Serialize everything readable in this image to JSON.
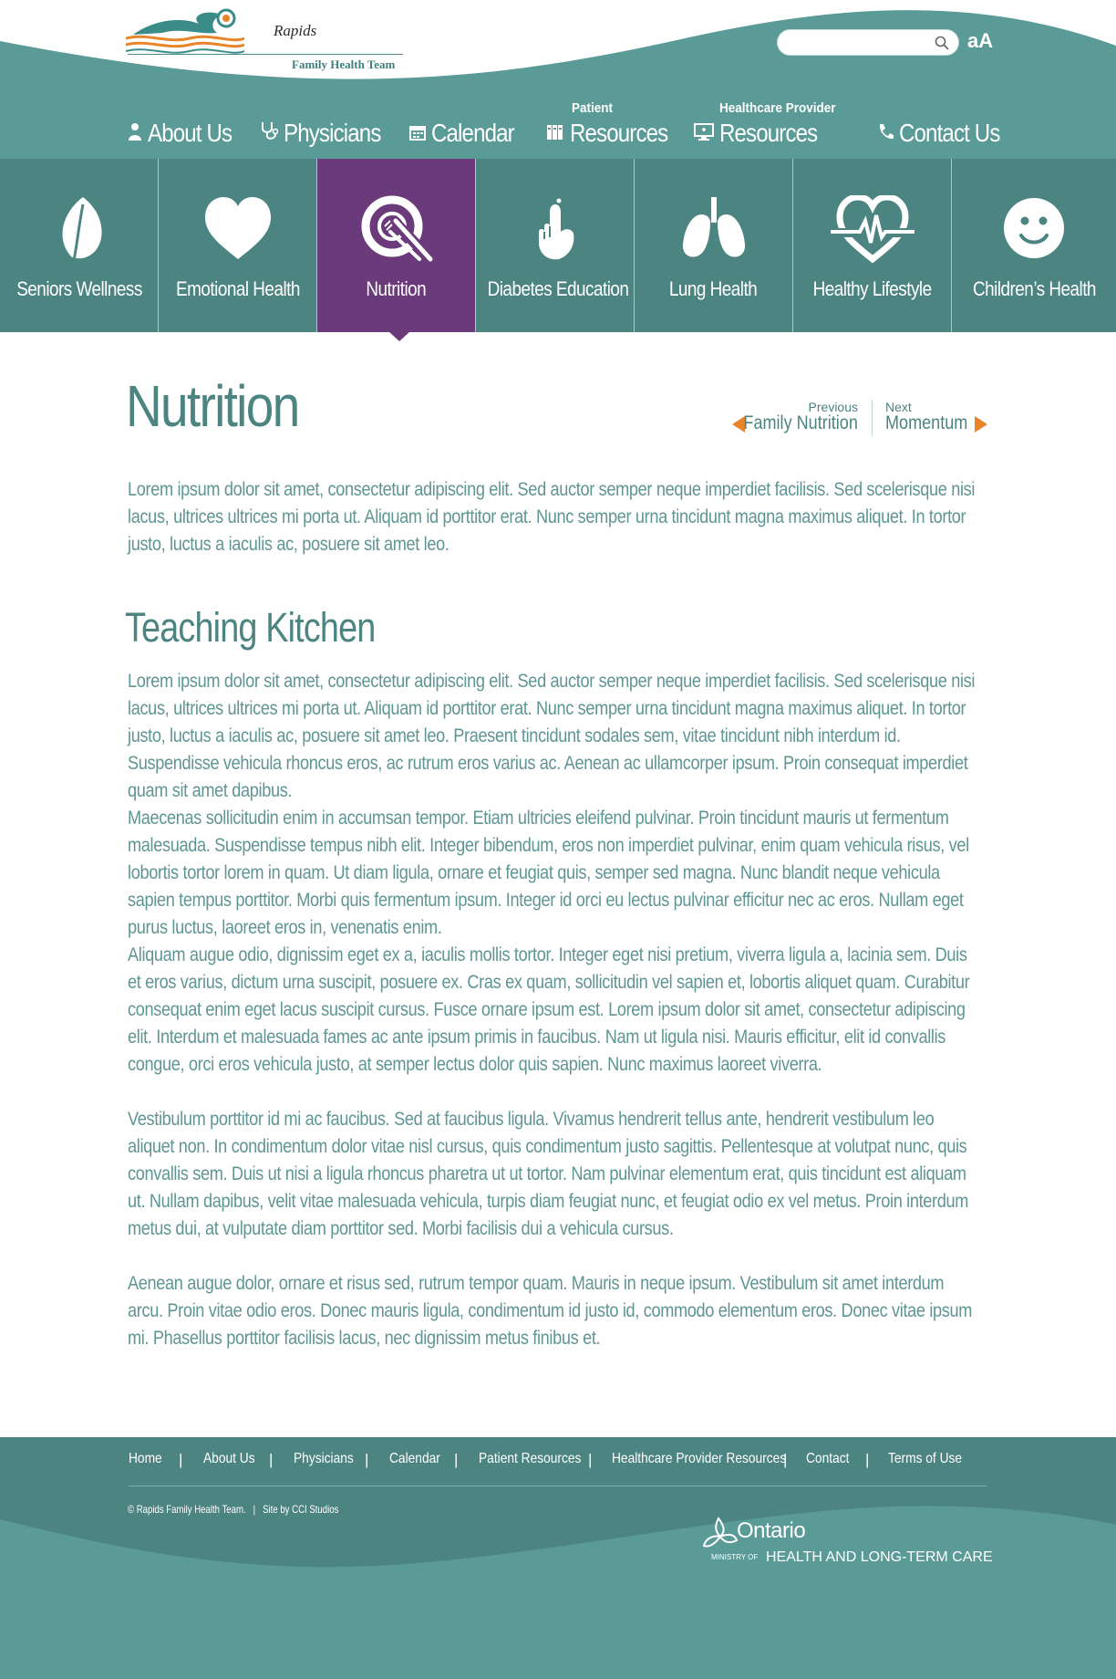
{
  "header": {
    "logo": {
      "brand": "Rapids",
      "subtitle": "Family Health Team"
    },
    "search": {
      "placeholder": "",
      "value": ""
    },
    "font_toggle": "aA",
    "nav": [
      {
        "id": "about",
        "label": "About Us",
        "prefix": "",
        "icon": "person-icon"
      },
      {
        "id": "physicians",
        "label": "Physicians",
        "prefix": "",
        "icon": "stethoscope-icon"
      },
      {
        "id": "calendar",
        "label": "Calendar",
        "prefix": "",
        "icon": "calendar-icon"
      },
      {
        "id": "patient-resources",
        "label": "Resources",
        "prefix": "Patient",
        "icon": "books-icon"
      },
      {
        "id": "provider-resources",
        "label": "Resources",
        "prefix": "Healthcare Provider",
        "icon": "monitor-icon"
      },
      {
        "id": "contact",
        "label": "Contact Us",
        "prefix": "",
        "icon": "phone-icon"
      }
    ]
  },
  "categories": [
    {
      "label": "Seniors Wellness",
      "icon": "leaf-icon",
      "active": false
    },
    {
      "label": "Emotional Health",
      "icon": "heart-icon",
      "active": false
    },
    {
      "label": "Nutrition",
      "icon": "plate-fork-knife-icon",
      "active": true
    },
    {
      "label": "Diabetes Education",
      "icon": "finger-prick-icon",
      "active": false
    },
    {
      "label": "Lung Health",
      "icon": "lungs-icon",
      "active": false
    },
    {
      "label": "Healthy Lifestyle",
      "icon": "heartbeat-icon",
      "active": false
    },
    {
      "label": "Children’s Health",
      "icon": "smiley-icon",
      "active": false
    }
  ],
  "content": {
    "title": "Nutrition",
    "prev": {
      "small": "Previous",
      "label": "Family Nutrition"
    },
    "next": {
      "small": "Next",
      "label": "Momentum"
    },
    "intro": "Lorem ipsum dolor sit amet, consectetur adipiscing elit. Sed auctor semper neque imperdiet facilisis. Sed scelerisque nisi lacus, ultrices ultrices mi porta ut. Aliquam id porttitor erat. Nunc semper urna tincidunt magna maximus aliquet. In tortor justo, luctus a iaculis ac, posuere sit amet leo.",
    "section_title": "Teaching Kitchen",
    "paragraphs": [
      "Lorem ipsum dolor sit amet, consectetur adipiscing elit. Sed auctor semper neque imperdiet facilisis. Sed scelerisque nisi lacus, ultrices ultrices mi porta ut. Aliquam id porttitor erat. Nunc semper urna tincidunt magna maximus aliquet. In tortor justo, luctus a iaculis ac, posuere sit amet leo. Praesent tincidunt sodales sem, vitae tincidunt nibh interdum id. Suspendisse vehicula rhoncus eros, ac rutrum eros varius ac. Aenean ac ullamcorper ipsum. Proin consequat imperdiet quam sit amet dapibus.",
      "Maecenas sollicitudin enim in accumsan tempor. Etiam ultricies eleifend pulvinar. Proin tincidunt mauris ut fermentum malesuada. Suspendisse tempus nibh elit. Integer bibendum, eros non imperdiet pulvinar, enim quam vehicula risus, vel lobortis tortor lorem in quam. Ut diam ligula, ornare et feugiat quis, semper sed magna. Nunc blandit neque vehicula sapien tempus porttitor. Morbi quis fermentum ipsum. Integer id orci eu lectus pulvinar efficitur nec ac eros. Nullam eget purus luctus, laoreet eros in, venenatis enim.",
      "Aliquam augue odio, dignissim eget ex a, iaculis mollis tortor. Integer eget nisi pretium, viverra ligula a, lacinia sem. Duis et eros varius, dictum urna suscipit, posuere ex. Cras ex quam, sollicitudin vel sapien et, lobortis aliquet quam. Curabitur consequat enim eget lacus suscipit cursus. Fusce ornare ipsum est. Lorem ipsum dolor sit amet, consectetur adipiscing elit. Interdum et malesuada fames ac ante ipsum primis in faucibus. Nam ut ligula nisi. Mauris efficitur, elit id convallis congue, orci eros vehicula justo, at semper lectus dolor quis sapien. Nunc maximus laoreet viverra.",
      "Vestibulum porttitor id mi ac faucibus. Sed at faucibus ligula. Vivamus hendrerit tellus ante, hendrerit vestibulum leo aliquet non. In condimentum dolor vitae nisl cursus, quis condimentum justo sagittis. Pellentesque at volutpat nunc, quis convallis sem. Duis ut nisi a ligula rhoncus pharetra ut ut tortor. Nam pulvinar elementum erat, quis tincidunt est aliquam ut. Nullam dapibus, velit vitae malesuada vehicula, turpis diam feugiat nunc, et feugiat odio ex vel metus. Proin interdum metus dui, at vulputate diam porttitor sed. Morbi facilisis dui a vehicula cursus.",
      "Aenean augue dolor, ornare et risus sed, rutrum tempor quam. Mauris in neque ipsum. Vestibulum sit amet interdum arcu. Proin vitae odio eros. Donec mauris ligula, condimentum id justo id, commodo elementum eros. Donec vitae ipsum mi. Phasellus porttitor facilisis lacus, nec dignissim metus finibus et."
    ]
  },
  "footer": {
    "links": [
      "Home",
      "About Us",
      "Physicians",
      "Calendar",
      "Patient Resources",
      "Healthcare Provider Resources",
      "Contact",
      "Terms of Use"
    ],
    "separator": "|",
    "copyright": "© Rapids Family Health Team.",
    "credit": "Site by CCI Studios",
    "ontario": {
      "word": "Ontario",
      "ministry_of": "MINISTRY OF",
      "ministry": "HEALTH AND LONG-TERM CARE"
    }
  },
  "colors": {
    "teal": "#5a9a97",
    "dark_teal": "#4c8482",
    "purple": "#6a3a7b",
    "orange": "#e8852a",
    "text": "#5f9593"
  }
}
